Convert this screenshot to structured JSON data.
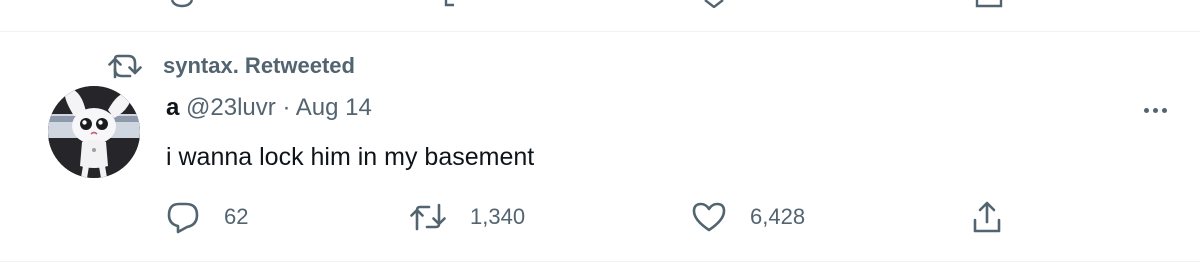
{
  "previous_tweet": {
    "icons": [
      "reply-icon",
      "retweet-icon",
      "like-icon",
      "share-icon"
    ]
  },
  "social_context": {
    "icon": "retweet-icon",
    "text": "syntax. Retweeted"
  },
  "tweet": {
    "avatar": "avatar",
    "author_name": "a",
    "handle": "@23luvr",
    "separator": "·",
    "date": "Aug 14",
    "text": "i wanna lock him in my basement",
    "more_icon": "more-icon",
    "actions": {
      "reply": {
        "icon": "reply-icon",
        "count": "62"
      },
      "retweet": {
        "icon": "retweet-icon",
        "count": "1,340"
      },
      "like": {
        "icon": "heart-icon",
        "count": "6,428"
      },
      "share": {
        "icon": "share-icon"
      }
    }
  },
  "colors": {
    "text_primary": "#0f1419",
    "text_secondary": "#536471",
    "divider": "#eff3f4",
    "background": "#ffffff"
  }
}
